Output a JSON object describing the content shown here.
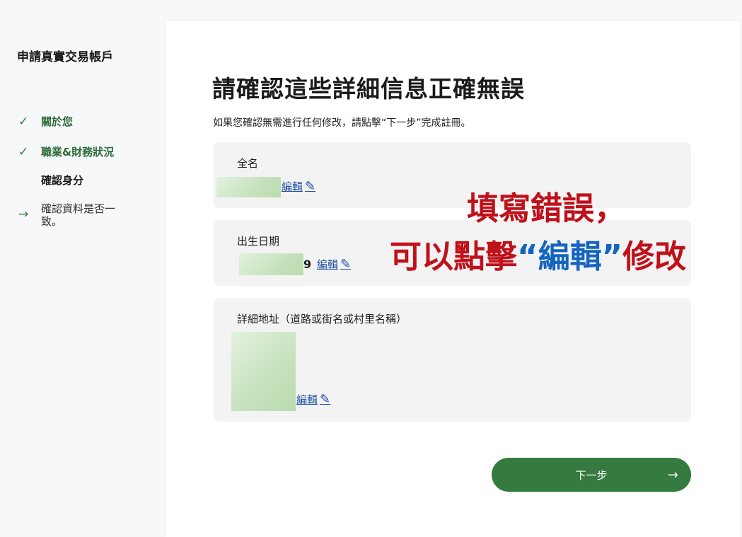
{
  "sidebar": {
    "title": "申請真實交易帳戶",
    "steps": [
      {
        "label": "關於您",
        "state": "done",
        "icon": "check-icon"
      },
      {
        "label": "職業&財務狀況",
        "state": "done",
        "icon": "check-icon"
      },
      {
        "label": "確認身分",
        "state": "current",
        "icon": ""
      },
      {
        "label": "確認資料是否一致。",
        "state": "upcoming",
        "icon": "arrow-right-icon"
      }
    ]
  },
  "main": {
    "title": "請確認這些詳細信息正確無誤",
    "subtitle": "如果您確認無需進行任何修改，請點擊“下一步”完成註冊。",
    "fields": [
      {
        "label": "全名",
        "value_visible": "",
        "edit_label": "編輯"
      },
      {
        "label": "出生日期",
        "value_visible": "9",
        "edit_label": "編輯"
      },
      {
        "label": "詳細地址（道路或街名或村里名稱）",
        "value_visible": "",
        "edit_label": "編輯"
      }
    ],
    "next_button": {
      "label": "下一步",
      "icon": "arrow-right-icon"
    }
  },
  "annotation": {
    "line1": "填寫錯誤，",
    "line2_prefix": "可以點擊",
    "line2_highlight": "“編輯”",
    "line2_suffix": "修改"
  },
  "colors": {
    "accent_green": "#357a3e",
    "link_blue": "#1f4fa3",
    "annotation_red": "#c0101a",
    "annotation_blue": "#1565c0"
  }
}
